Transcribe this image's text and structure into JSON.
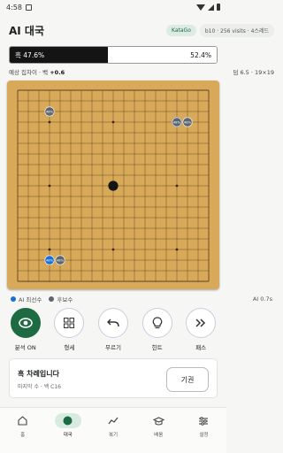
{
  "status_bar": {
    "time": "4:58"
  },
  "header": {
    "title": "AI 대국",
    "engine_chip": "KataGo",
    "info_chip": "b10 · 256 visits · 4스레드"
  },
  "winrate": {
    "black_label": "흑 47.6%",
    "white_label": "52.4%",
    "black_fraction": 0.476
  },
  "score": {
    "label": "예상 집차이 · 백",
    "value": "+0.6",
    "rules": "덤 6.5 · 19×19"
  },
  "board": {
    "size": 19,
    "black_stones": [
      [
        9,
        9
      ]
    ],
    "white_stones": [
      [
        15,
        3
      ]
    ],
    "candidates": [
      {
        "x": 3,
        "y": 2,
        "label": "48%",
        "kind": "best"
      },
      {
        "x": 4,
        "y": 2,
        "label": "48%",
        "kind": "alt"
      },
      {
        "x": 15,
        "y": 15,
        "label": "48%",
        "kind": "alt"
      },
      {
        "x": 16,
        "y": 15,
        "label": "48%",
        "kind": "alt"
      },
      {
        "x": 3,
        "y": 16,
        "label": "48%",
        "kind": "alt"
      }
    ]
  },
  "legend": {
    "best_label": "AI 최선수",
    "alt_label": "후보수",
    "version": "AI 0.7s"
  },
  "tools": [
    {
      "label": "분석 ON",
      "icon": "eye-icon"
    },
    {
      "label": "형세",
      "icon": "grid-icon"
    },
    {
      "label": "무르기",
      "icon": "undo-icon"
    },
    {
      "label": "힌트",
      "icon": "bulb-icon"
    },
    {
      "label": "패스",
      "icon": "pass-icon"
    }
  ],
  "turn": {
    "title": "흑 차례입니다",
    "subtitle": "마지막 수 · 백 C16",
    "resign_label": "기권"
  },
  "nav": [
    {
      "label": "홈",
      "icon": "home-icon"
    },
    {
      "label": "대국",
      "icon": "play-icon"
    },
    {
      "label": "복기",
      "icon": "chart-icon"
    },
    {
      "label": "배움",
      "icon": "learn-icon"
    },
    {
      "label": "설정",
      "icon": "settings-icon"
    }
  ],
  "colors": {
    "accent": "#1e6a43",
    "best": "#1a6fd6",
    "alt": "#5b6670",
    "board": "#d9a95a"
  }
}
